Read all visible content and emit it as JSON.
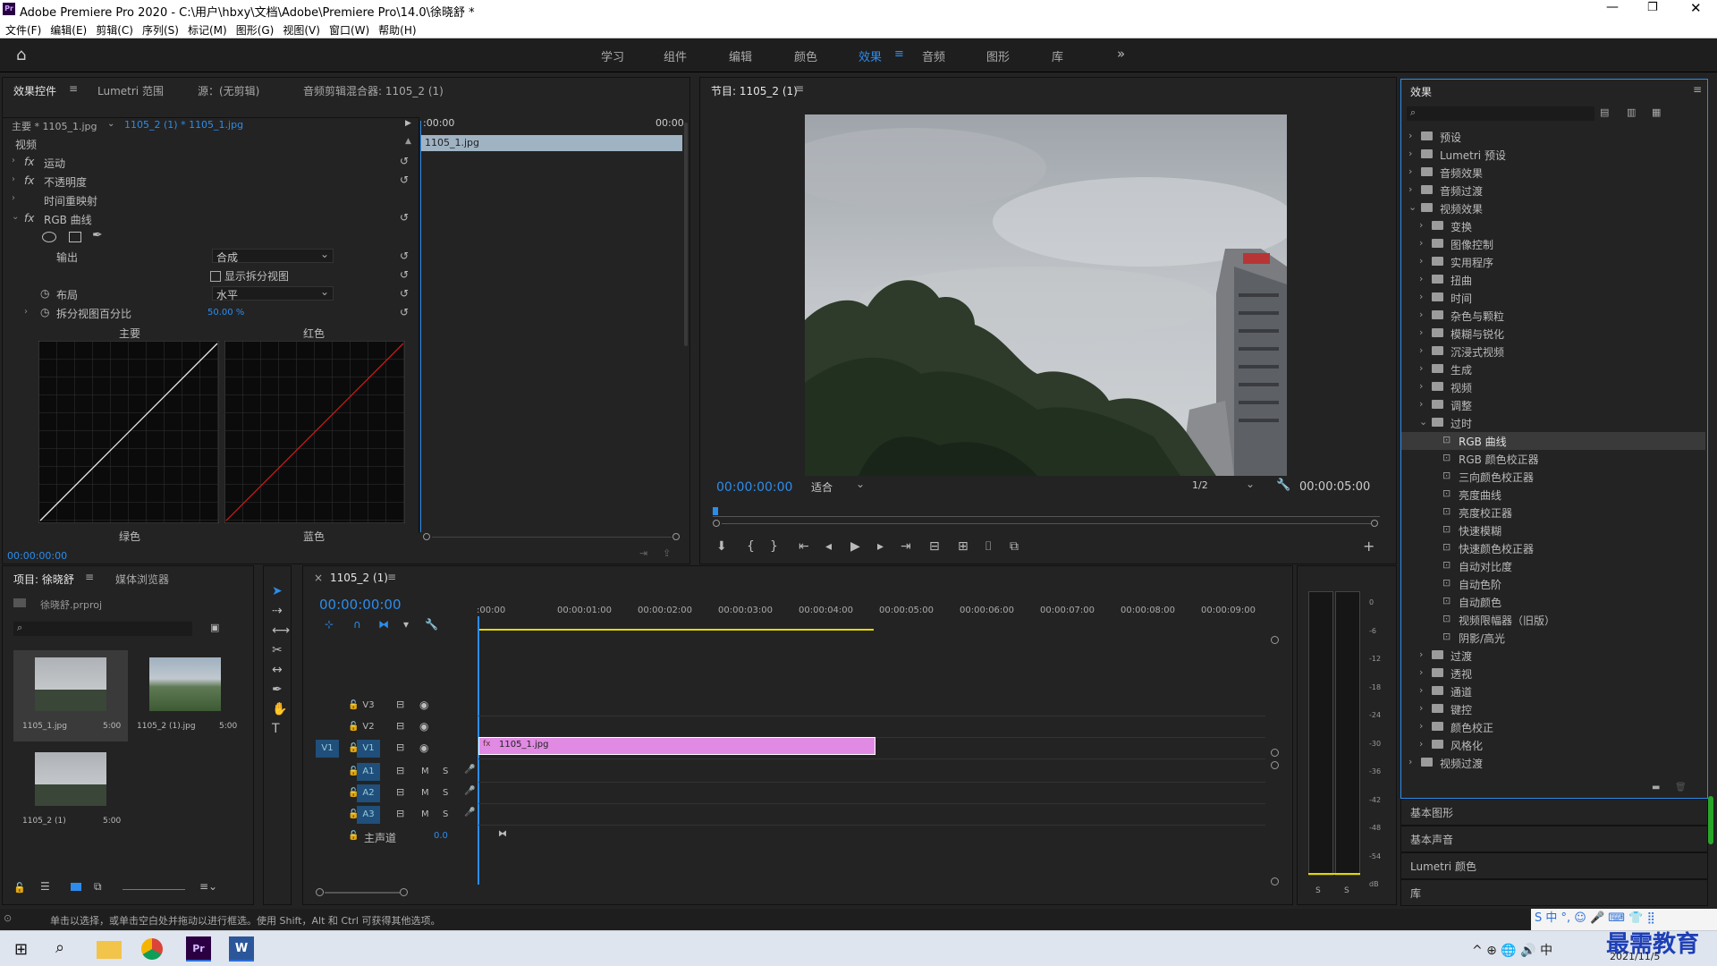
{
  "window": {
    "app_title": "Adobe Premiere Pro 2020 - C:\\用户\\hbxy\\文档\\Adobe\\Premiere Pro\\14.0\\徐晓舒 *"
  },
  "menu": [
    "文件(F)",
    "编辑(E)",
    "剪辑(C)",
    "序列(S)",
    "标记(M)",
    "图形(G)",
    "视图(V)",
    "窗口(W)",
    "帮助(H)"
  ],
  "workspaces": [
    "学习",
    "组件",
    "编辑",
    "颜色",
    "效果",
    "音频",
    "图形",
    "库"
  ],
  "active_workspace": "效果",
  "effect_controls": {
    "tabs": [
      "效果控件",
      "Lumetri 范围",
      "源：(无剪辑)",
      "音频剪辑混合器: 1105_2 (1)"
    ],
    "master_label": "主要 * 1105_1.jpg",
    "sequence_label": "1105_2 (1) * 1105_1.jpg",
    "ruler_start": ":00:00",
    "ruler_end": "00:00",
    "clip_name": "1105_1.jpg",
    "section_video": "视频",
    "effects": [
      "运动",
      "不透明度",
      "时间重映射",
      "RGB 曲线"
    ],
    "output_label": "输出",
    "output_value": "合成",
    "split_view_label": "显示拆分视图",
    "layout_label": "布局",
    "layout_value": "水平",
    "split_pct_label": "拆分视图百分比",
    "split_pct_value": "50.00 %",
    "curve_labels": [
      "主要",
      "红色",
      "绿色",
      "蓝色"
    ],
    "timecode": "00:00:00:00"
  },
  "program": {
    "title": "节目: 1105_2 (1)",
    "timecode": "00:00:00:00",
    "fit": "适合",
    "resolution": "1/2",
    "duration": "00:00:05:00"
  },
  "project": {
    "tabs": [
      "项目: 徐晓舒",
      "媒体浏览器"
    ],
    "file": "徐晓舒.prproj",
    "items": [
      {
        "name": "1105_1.jpg",
        "dur": "5:00"
      },
      {
        "name": "1105_2 (1).jpg",
        "dur": "5:00"
      },
      {
        "name": "1105_2 (1)",
        "dur": "5:00"
      }
    ]
  },
  "timeline": {
    "tab": "1105_2 (1)",
    "timecode": "00:00:00:00",
    "ruler": [
      ":00:00",
      "00:00:01:00",
      "00:00:02:00",
      "00:00:03:00",
      "00:00:04:00",
      "00:00:05:00",
      "00:00:06:00",
      "00:00:07:00",
      "00:00:08:00",
      "00:00:09:00"
    ],
    "tracks": [
      "V3",
      "V2",
      "V1",
      "A1",
      "A2",
      "A3"
    ],
    "master": "主声道",
    "master_val": "0.0",
    "clip": "1105_1.jpg",
    "src_patch": "V1"
  },
  "meter": {
    "scale": [
      "0",
      "-6",
      "-12",
      "-18",
      "-24",
      "-30",
      "-36",
      "-42",
      "-48",
      "-54",
      "dB"
    ],
    "solo": [
      "S",
      "S"
    ]
  },
  "effects_panel": {
    "title": "效果",
    "tree": [
      {
        "label": "预设",
        "level": 0,
        "open": false
      },
      {
        "label": "Lumetri 预设",
        "level": 0,
        "open": false
      },
      {
        "label": "音频效果",
        "level": 0,
        "open": false
      },
      {
        "label": "音频过渡",
        "level": 0,
        "open": false
      },
      {
        "label": "视频效果",
        "level": 0,
        "open": true
      },
      {
        "label": "变换",
        "level": 1,
        "open": false
      },
      {
        "label": "图像控制",
        "level": 1,
        "open": false
      },
      {
        "label": "实用程序",
        "level": 1,
        "open": false
      },
      {
        "label": "扭曲",
        "level": 1,
        "open": false
      },
      {
        "label": "时间",
        "level": 1,
        "open": false
      },
      {
        "label": "杂色与颗粒",
        "level": 1,
        "open": false
      },
      {
        "label": "模糊与锐化",
        "level": 1,
        "open": false
      },
      {
        "label": "沉浸式视频",
        "level": 1,
        "open": false
      },
      {
        "label": "生成",
        "level": 1,
        "open": false
      },
      {
        "label": "视频",
        "level": 1,
        "open": false
      },
      {
        "label": "调整",
        "level": 1,
        "open": false
      },
      {
        "label": "过时",
        "level": 1,
        "open": true
      },
      {
        "label": "RGB 曲线",
        "level": 2,
        "selected": true
      },
      {
        "label": "RGB 颜色校正器",
        "level": 2
      },
      {
        "label": "三向颜色校正器",
        "level": 2
      },
      {
        "label": "亮度曲线",
        "level": 2
      },
      {
        "label": "亮度校正器",
        "level": 2
      },
      {
        "label": "快速模糊",
        "level": 2
      },
      {
        "label": "快速颜色校正器",
        "level": 2
      },
      {
        "label": "自动对比度",
        "level": 2
      },
      {
        "label": "自动色阶",
        "level": 2
      },
      {
        "label": "自动颜色",
        "level": 2
      },
      {
        "label": "视频限幅器（旧版）",
        "level": 2
      },
      {
        "label": "阴影/高光",
        "level": 2
      },
      {
        "label": "过渡",
        "level": 1,
        "open": false
      },
      {
        "label": "透视",
        "level": 1,
        "open": false
      },
      {
        "label": "通道",
        "level": 1,
        "open": false
      },
      {
        "label": "键控",
        "level": 1,
        "open": false
      },
      {
        "label": "颜色校正",
        "level": 1,
        "open": false
      },
      {
        "label": "风格化",
        "level": 1,
        "open": false
      },
      {
        "label": "视频过渡",
        "level": 0,
        "open": false
      }
    ],
    "bottom": [
      "基本图形",
      "基本声音",
      "Lumetri 颜色",
      "库"
    ]
  },
  "status": "单击以选择，或单击空白处并拖动以进行框选。使用 Shift，Alt 和 Ctrl 可获得其他选项。",
  "taskbar": {
    "date": "2021/11/5",
    "watermark": "最需教育"
  }
}
